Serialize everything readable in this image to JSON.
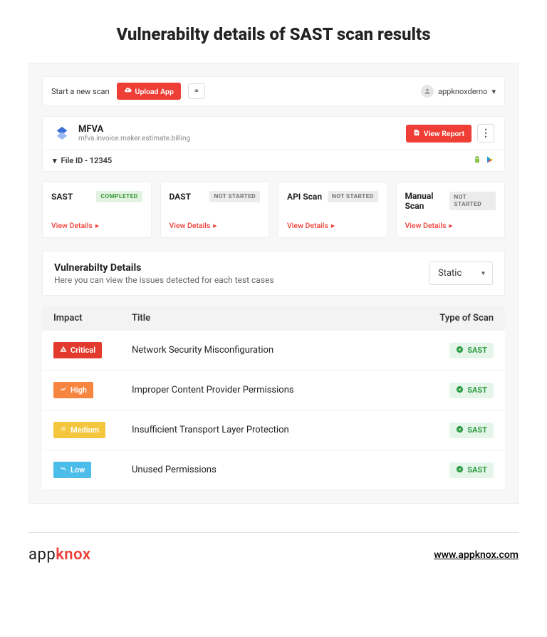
{
  "page_title": "Vulnerabilty details of SAST scan results",
  "top_bar": {
    "start_scan": "Start a new scan",
    "upload_label": "Upload App",
    "link_icon_glyph": "⚭",
    "user_name": "appknoxdemo"
  },
  "app": {
    "name": "MFVA",
    "package": "mfva.invoice.maker.estimate.billing",
    "view_report_label": "View Report",
    "file_id_label": "File ID - 12345"
  },
  "scans": [
    {
      "name": "SAST",
      "status": "COMPLETED",
      "status_class": "completed",
      "view_details": "View Details"
    },
    {
      "name": "DAST",
      "status": "NOT STARTED",
      "status_class": "notstarted",
      "view_details": "View Details"
    },
    {
      "name": "API Scan",
      "status": "NOT STARTED",
      "status_class": "notstarted",
      "view_details": "View Details"
    },
    {
      "name": "Manual Scan",
      "status": "NOT STARTED",
      "status_class": "notstarted",
      "view_details": "View Details"
    }
  ],
  "vuln_section": {
    "title": "Vulnerabilty Details",
    "subtitle": "Here you can view the issues detected for each test cases",
    "filter_value": "Static"
  },
  "table": {
    "headers": {
      "impact": "Impact",
      "title": "Title",
      "type": "Type of Scan"
    },
    "rows": [
      {
        "impact": "Critical",
        "impact_class": "critical",
        "title": "Network Security Misconfiguration",
        "type": "SAST"
      },
      {
        "impact": "High",
        "impact_class": "high",
        "title": "Improper Content Provider Permissions",
        "type": "SAST"
      },
      {
        "impact": "Medium",
        "impact_class": "medium",
        "title": "Insufficient Transport Layer Protection",
        "type": "SAST"
      },
      {
        "impact": "Low",
        "impact_class": "low",
        "title": "Unused Permissions",
        "type": "SAST"
      }
    ]
  },
  "footer": {
    "logo_app": "app",
    "logo_knox": "knox",
    "url": "www.appknox.com"
  }
}
